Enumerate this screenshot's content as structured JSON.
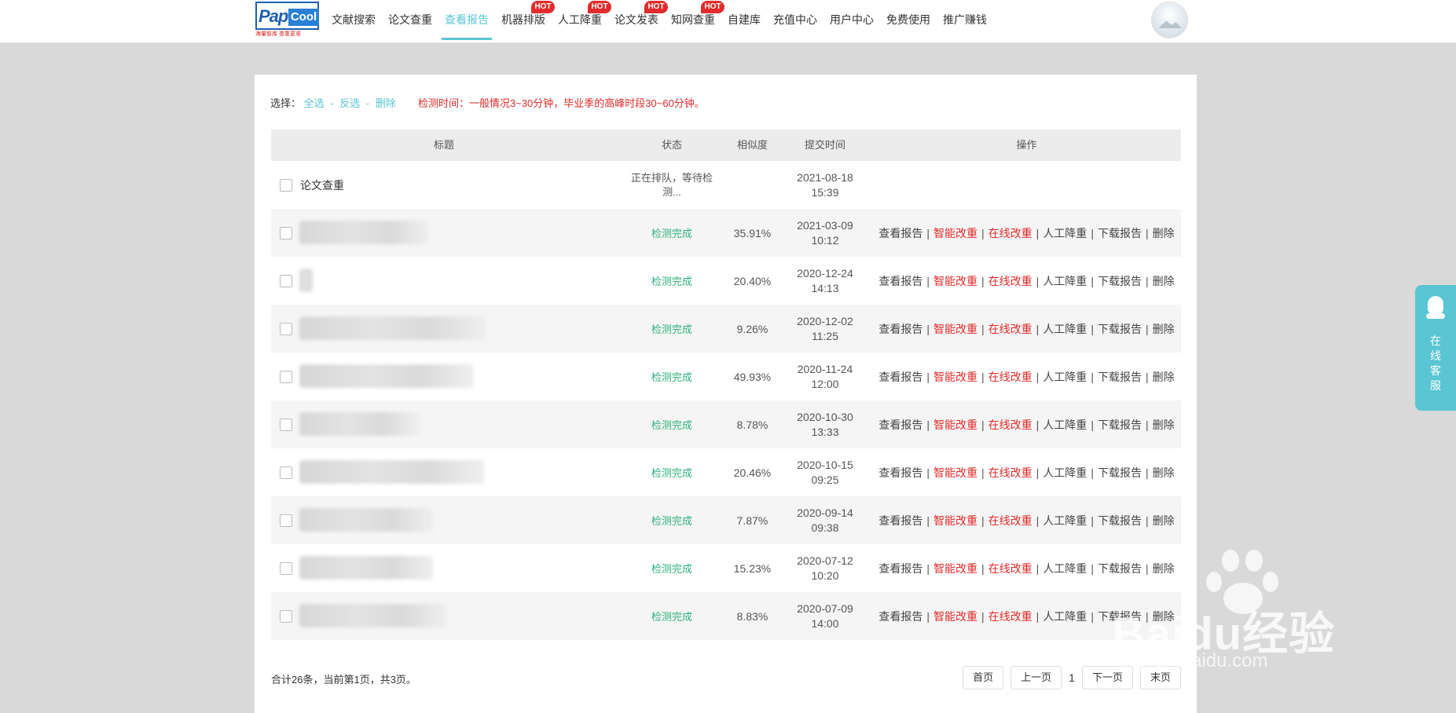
{
  "logo": {
    "part1": "Paper",
    "part2": "Cool",
    "tagline": "海量智库 查重更准"
  },
  "nav": [
    {
      "label": "文献搜索",
      "hot": false,
      "active": false
    },
    {
      "label": "论文查重",
      "hot": false,
      "active": false
    },
    {
      "label": "查看报告",
      "hot": false,
      "active": true
    },
    {
      "label": "机器排版",
      "hot": true,
      "active": false
    },
    {
      "label": "人工降重",
      "hot": true,
      "active": false
    },
    {
      "label": "论文发表",
      "hot": true,
      "active": false
    },
    {
      "label": "知网查重",
      "hot": true,
      "active": false
    },
    {
      "label": "自建库",
      "hot": false,
      "active": false
    },
    {
      "label": "充值中心",
      "hot": false,
      "active": false
    },
    {
      "label": "用户中心",
      "hot": false,
      "active": false
    },
    {
      "label": "免费使用",
      "hot": false,
      "active": false
    },
    {
      "label": "推广赚钱",
      "hot": false,
      "active": false
    }
  ],
  "hot_label": "HOT",
  "toolbar": {
    "select_label": "选择：",
    "select_all": "全选",
    "invert": "反选",
    "delete": "删除",
    "separator": "-",
    "notice": "检测时间：一般情况3~30分钟，毕业季的高峰时段30~60分钟。"
  },
  "table": {
    "headers": {
      "title": "标题",
      "status": "状态",
      "similarity": "相似度",
      "time": "提交时间",
      "ops": "操作"
    },
    "rows": [
      {
        "title": "论文查重",
        "status": "正在排队，等待检测...",
        "done": false,
        "similarity": "",
        "date": "2021-08-18",
        "clock": "15:39"
      },
      {
        "title": "",
        "status": "检测完成",
        "done": true,
        "similarity": "35.91%",
        "date": "2021-03-09",
        "clock": "10:12"
      },
      {
        "title": "",
        "status": "检测完成",
        "done": true,
        "similarity": "20.40%",
        "date": "2020-12-24",
        "clock": "14:13"
      },
      {
        "title": "",
        "status": "检测完成",
        "done": true,
        "similarity": "9.26%",
        "date": "2020-12-02",
        "clock": "11:25"
      },
      {
        "title": "",
        "status": "检测完成",
        "done": true,
        "similarity": "49.93%",
        "date": "2020-11-24",
        "clock": "12:00"
      },
      {
        "title": "",
        "status": "检测完成",
        "done": true,
        "similarity": "8.78%",
        "date": "2020-10-30",
        "clock": "13:33"
      },
      {
        "title": "",
        "status": "检测完成",
        "done": true,
        "similarity": "20.46%",
        "date": "2020-10-15",
        "clock": "09:25"
      },
      {
        "title": "",
        "status": "检测完成",
        "done": true,
        "similarity": "7.87%",
        "date": "2020-09-14",
        "clock": "09:38"
      },
      {
        "title": "",
        "status": "检测完成",
        "done": true,
        "similarity": "15.23%",
        "date": "2020-07-12",
        "clock": "10:20"
      },
      {
        "title": "",
        "status": "检测完成",
        "done": true,
        "similarity": "8.83%",
        "date": "2020-07-09",
        "clock": "14:00"
      }
    ],
    "ops": [
      {
        "label": "查看报告",
        "highlight": false
      },
      {
        "label": "智能改重",
        "highlight": true
      },
      {
        "label": "在线改重",
        "highlight": true
      },
      {
        "label": "人工降重",
        "highlight": false
      },
      {
        "label": "下载报告",
        "highlight": false
      },
      {
        "label": "删除",
        "highlight": false
      }
    ],
    "op_separator": "|"
  },
  "footer": {
    "summary": "合计26条，当前第1页，共3页。"
  },
  "pagination": {
    "first": "首页",
    "prev": "上一页",
    "current": "1",
    "next": "下一页",
    "last": "末页"
  },
  "service": {
    "label": "在线客服"
  },
  "watermark": {
    "brand": "Baidu经验",
    "url": "jingyan.baidu.com"
  },
  "colors": {
    "accent": "#5ac5d3",
    "hot": "#e32b2b",
    "done": "#2fb07a",
    "notice": "#e32b2b"
  }
}
